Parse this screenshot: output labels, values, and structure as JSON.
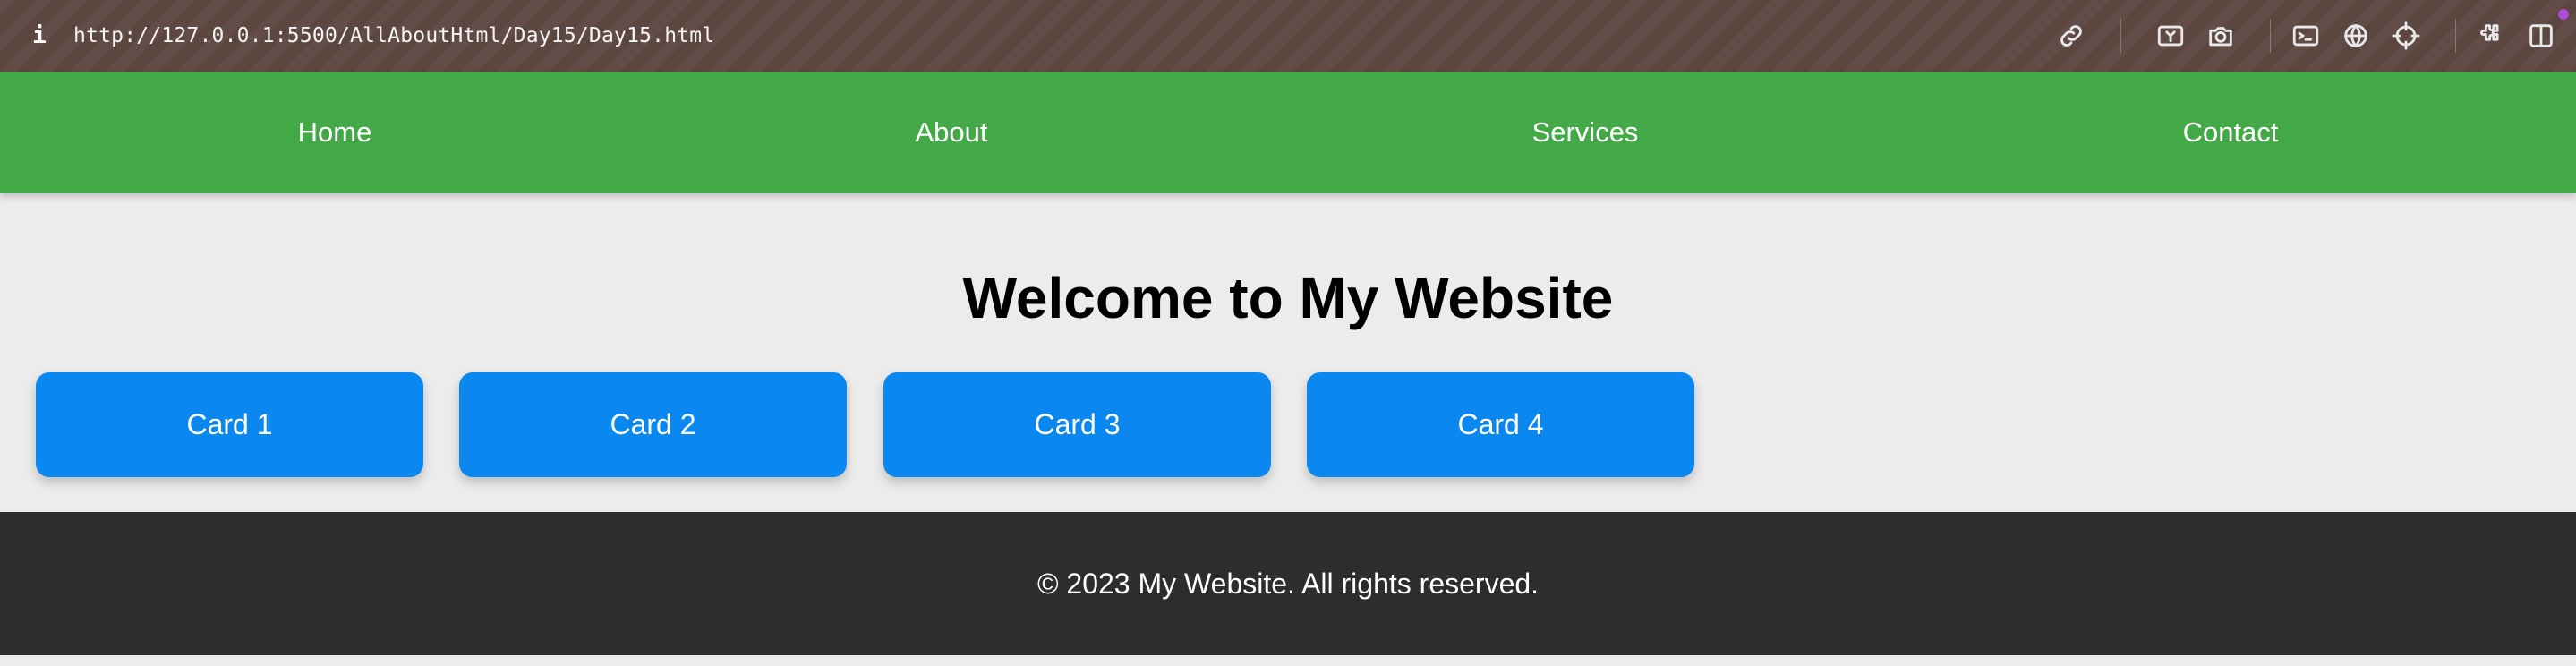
{
  "browser": {
    "url": "http://127.0.0.1:5500/AllAboutHtml/Day15/Day15.html",
    "info_icon": "i",
    "toolbar_icons": [
      "link-icon",
      "screencast-icon",
      "camera-icon",
      "terminal-icon",
      "globe-icon",
      "crosshair-icon",
      "extensions-icon",
      "sidebar-icon"
    ]
  },
  "nav": {
    "items": [
      {
        "label": "Home"
      },
      {
        "label": "About"
      },
      {
        "label": "Services"
      },
      {
        "label": "Contact"
      }
    ],
    "color": "#43a947"
  },
  "main": {
    "heading": "Welcome to My Website",
    "cards": [
      {
        "label": "Card 1"
      },
      {
        "label": "Card 2"
      },
      {
        "label": "Card 3"
      },
      {
        "label": "Card 4"
      }
    ],
    "card_color": "#0a88ef"
  },
  "footer": {
    "text": "© 2023 My Website. All rights reserved.",
    "color": "#2d2d2d"
  }
}
